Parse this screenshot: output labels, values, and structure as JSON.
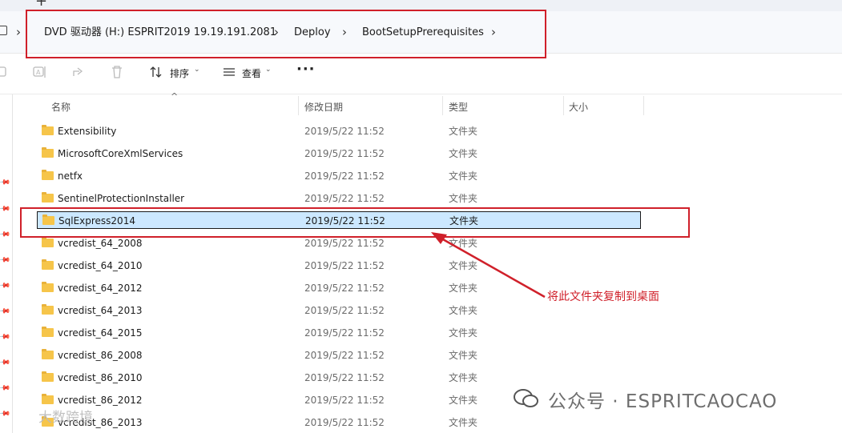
{
  "tabbar": {
    "new_tab_glyph": "+"
  },
  "breadcrumb": {
    "segments": [
      "DVD 驱动器 (H:) ESPRIT2019 19.19.191.2081",
      "Deploy",
      "BootSetupPrerequisites"
    ],
    "separator": "›"
  },
  "toolbar": {
    "sort_label": "排序",
    "view_label": "查看",
    "more_label": "···",
    "icons": [
      "copy-icon",
      "rename-icon",
      "share-icon",
      "delete-icon",
      "sort-icon",
      "view-icon"
    ]
  },
  "columns": {
    "name": "名称",
    "modified": "修改日期",
    "type": "类型",
    "size": "大小"
  },
  "rows": [
    {
      "name": "Extensibility",
      "date": "2019/5/22 11:52",
      "type": "文件夹"
    },
    {
      "name": "MicrosoftCoreXmlServices",
      "date": "2019/5/22 11:52",
      "type": "文件夹"
    },
    {
      "name": "netfx",
      "date": "2019/5/22 11:52",
      "type": "文件夹"
    },
    {
      "name": "SentinelProtectionInstaller",
      "date": "2019/5/22 11:52",
      "type": "文件夹"
    },
    {
      "name": "SqlExpress2014",
      "date": "2019/5/22 11:52",
      "type": "文件夹",
      "selected": true
    },
    {
      "name": "vcredist_64_2008",
      "date": "2019/5/22 11:52",
      "type": "文件夹"
    },
    {
      "name": "vcredist_64_2010",
      "date": "2019/5/22 11:52",
      "type": "文件夹"
    },
    {
      "name": "vcredist_64_2012",
      "date": "2019/5/22 11:52",
      "type": "文件夹"
    },
    {
      "name": "vcredist_64_2013",
      "date": "2019/5/22 11:52",
      "type": "文件夹"
    },
    {
      "name": "vcredist_64_2015",
      "date": "2019/5/22 11:52",
      "type": "文件夹"
    },
    {
      "name": "vcredist_86_2008",
      "date": "2019/5/22 11:52",
      "type": "文件夹"
    },
    {
      "name": "vcredist_86_2010",
      "date": "2019/5/22 11:52",
      "type": "文件夹"
    },
    {
      "name": "vcredist_86_2012",
      "date": "2019/5/22 11:52",
      "type": "文件夹"
    },
    {
      "name": "vcredist_86_2013",
      "date": "2019/5/22 11:52",
      "type": "文件夹"
    }
  ],
  "annotation": {
    "text": "将此文件夹复制到桌面",
    "color": "#d0202a"
  },
  "watermark": {
    "text": "公众号 · ESPRITCAOCAO",
    "bottom_text": "大数跨境"
  },
  "colors": {
    "selection": "#cce8ff",
    "folder": "#f6c54a",
    "annotation": "#d0202a"
  }
}
